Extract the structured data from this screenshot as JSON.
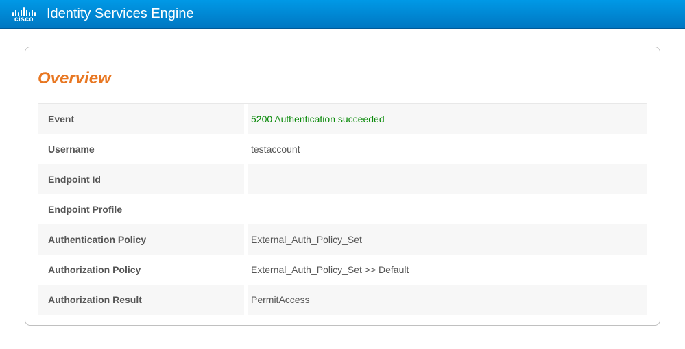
{
  "header": {
    "logo_text": "cisco",
    "title": "Identity Services Engine"
  },
  "panel": {
    "title": "Overview",
    "rows": [
      {
        "label": "Event",
        "value": "5200 Authentication succeeded",
        "success": true
      },
      {
        "label": "Username",
        "value": "testaccount"
      },
      {
        "label": "Endpoint Id",
        "value": ""
      },
      {
        "label": "Endpoint Profile",
        "value": ""
      },
      {
        "label": "Authentication Policy",
        "value": "External_Auth_Policy_Set"
      },
      {
        "label": "Authorization Policy",
        "value": "External_Auth_Policy_Set >> Default"
      },
      {
        "label": "Authorization Result",
        "value": "PermitAccess"
      }
    ]
  }
}
